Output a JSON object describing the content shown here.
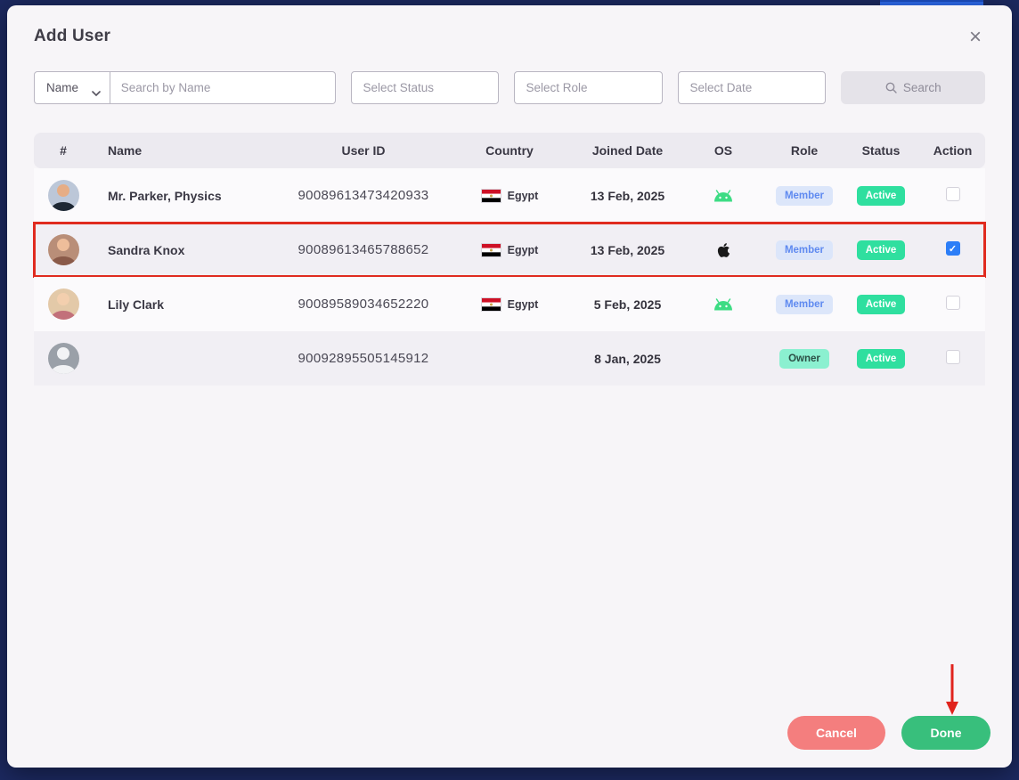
{
  "modal": {
    "title": "Add User",
    "close_icon": "×"
  },
  "filters": {
    "name_dropdown": {
      "label": "Name"
    },
    "search_input": {
      "placeholder": "Search by Name",
      "value": ""
    },
    "status_input": {
      "placeholder": "Select Status",
      "value": ""
    },
    "role_input": {
      "placeholder": "Select Role",
      "value": ""
    },
    "date_input": {
      "placeholder": "Select Date",
      "value": ""
    },
    "search_button": "Search"
  },
  "table": {
    "headers": [
      "#",
      "Name",
      "User ID",
      "Country",
      "Joined Date",
      "OS",
      "Role",
      "Status",
      "Action"
    ],
    "rows": [
      {
        "avatar": "male-suit",
        "name": "Mr. Parker, Physics",
        "user_id": "90089613473420933",
        "country": "Egypt",
        "joined": "13 Feb, 2025",
        "os": "android",
        "role": "Member",
        "status": "Active",
        "checked": false,
        "highlighted": false
      },
      {
        "avatar": "female-brunette",
        "name": "Sandra Knox",
        "user_id": "90089613465788652",
        "country": "Egypt",
        "joined": "13 Feb, 2025",
        "os": "apple",
        "role": "Member",
        "status": "Active",
        "checked": true,
        "highlighted": true
      },
      {
        "avatar": "female-blonde",
        "name": "Lily Clark",
        "user_id": "90089589034652220",
        "country": "Egypt",
        "joined": "5 Feb, 2025",
        "os": "android",
        "role": "Member",
        "status": "Active",
        "checked": false,
        "highlighted": false
      },
      {
        "avatar": "placeholder",
        "name": "",
        "user_id": "90092895505145912",
        "country": "",
        "joined": "8 Jan, 2025",
        "os": "",
        "role": "Owner",
        "status": "Active",
        "checked": false,
        "highlighted": false
      }
    ]
  },
  "footer": {
    "cancel_label": "Cancel",
    "done_label": "Done"
  },
  "colors": {
    "backdrop_navy": "#1c2960",
    "topbar_blue": "#2e6bf0",
    "modal_bg": "#f7f5f8",
    "selected_red": "#e02b1f",
    "active_green": "#2fdf9f",
    "owner_mint": "#8bf0d0",
    "member_blue_bg": "#dce6fa",
    "member_blue_text": "#5f8af0",
    "checkbox_blue": "#2d7ef7",
    "android_green": "#3ddc84",
    "cancel_red": "#f47e7e",
    "done_green": "#38bf7c",
    "arrow_red": "#e0231d"
  }
}
